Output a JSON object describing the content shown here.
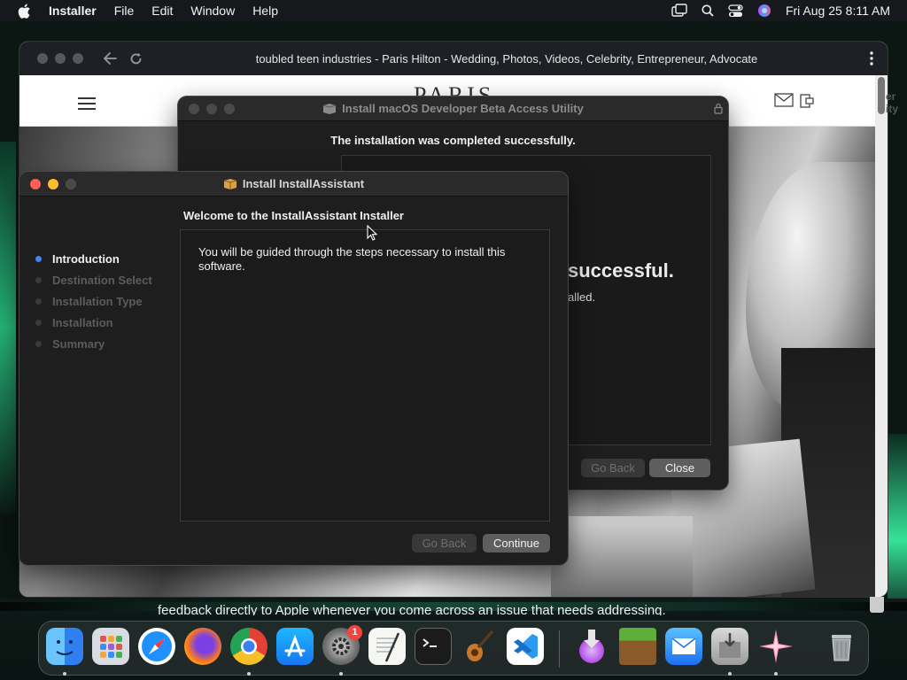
{
  "menubar": {
    "app_name": "Installer",
    "menus": [
      "File",
      "Edit",
      "Window",
      "Help"
    ],
    "clock": "Fri Aug 25  8:11 AM",
    "status_icons": [
      "screen-mirroring-icon",
      "spotlight-search-icon",
      "control-center-icon",
      "siri-icon"
    ]
  },
  "browser": {
    "title": "toubled teen industries - Paris Hilton - Wedding, Photos, Videos, Celebrity, Entrepreneur, Advocate",
    "site_logo": "PARIS",
    "peek_text": "er\nity",
    "caption": "feedback directly to Apple whenever you come across an issue that needs addressing."
  },
  "bg_installer": {
    "title": "Install macOS Developer Beta Access Utility",
    "completion_message": "The installation was completed successfully.",
    "big_text": "successful.",
    "small_text": "alled.",
    "back_label": "Go Back",
    "close_label": "Close"
  },
  "fg_installer": {
    "title": "Install InstallAssistant",
    "welcome_heading": "Welcome to the InstallAssistant Installer",
    "body_text": "You will be guided through the steps necessary to install this software.",
    "steps": [
      {
        "label": "Introduction",
        "active": true
      },
      {
        "label": "Destination Select",
        "active": false
      },
      {
        "label": "Installation Type",
        "active": false
      },
      {
        "label": "Installation",
        "active": false
      },
      {
        "label": "Summary",
        "active": false
      }
    ],
    "back_label": "Go Back",
    "continue_label": "Continue"
  },
  "dock": {
    "apps": [
      "Finder",
      "Launchpad",
      "Safari",
      "Firefox",
      "Google Chrome",
      "App Store",
      "System Settings",
      "TextEdit",
      "Terminal",
      "GarageBand",
      "Visual Studio Code",
      "Downloads",
      "Minecraft",
      "Mail",
      "Installer",
      "Sparkle",
      "Trash"
    ],
    "settings_badge": "1",
    "colors": {
      "finder": "#3d8bf2",
      "safari": "#1e90ff",
      "chrome_red": "#e34133",
      "vscode": "#2a9bf0"
    }
  }
}
